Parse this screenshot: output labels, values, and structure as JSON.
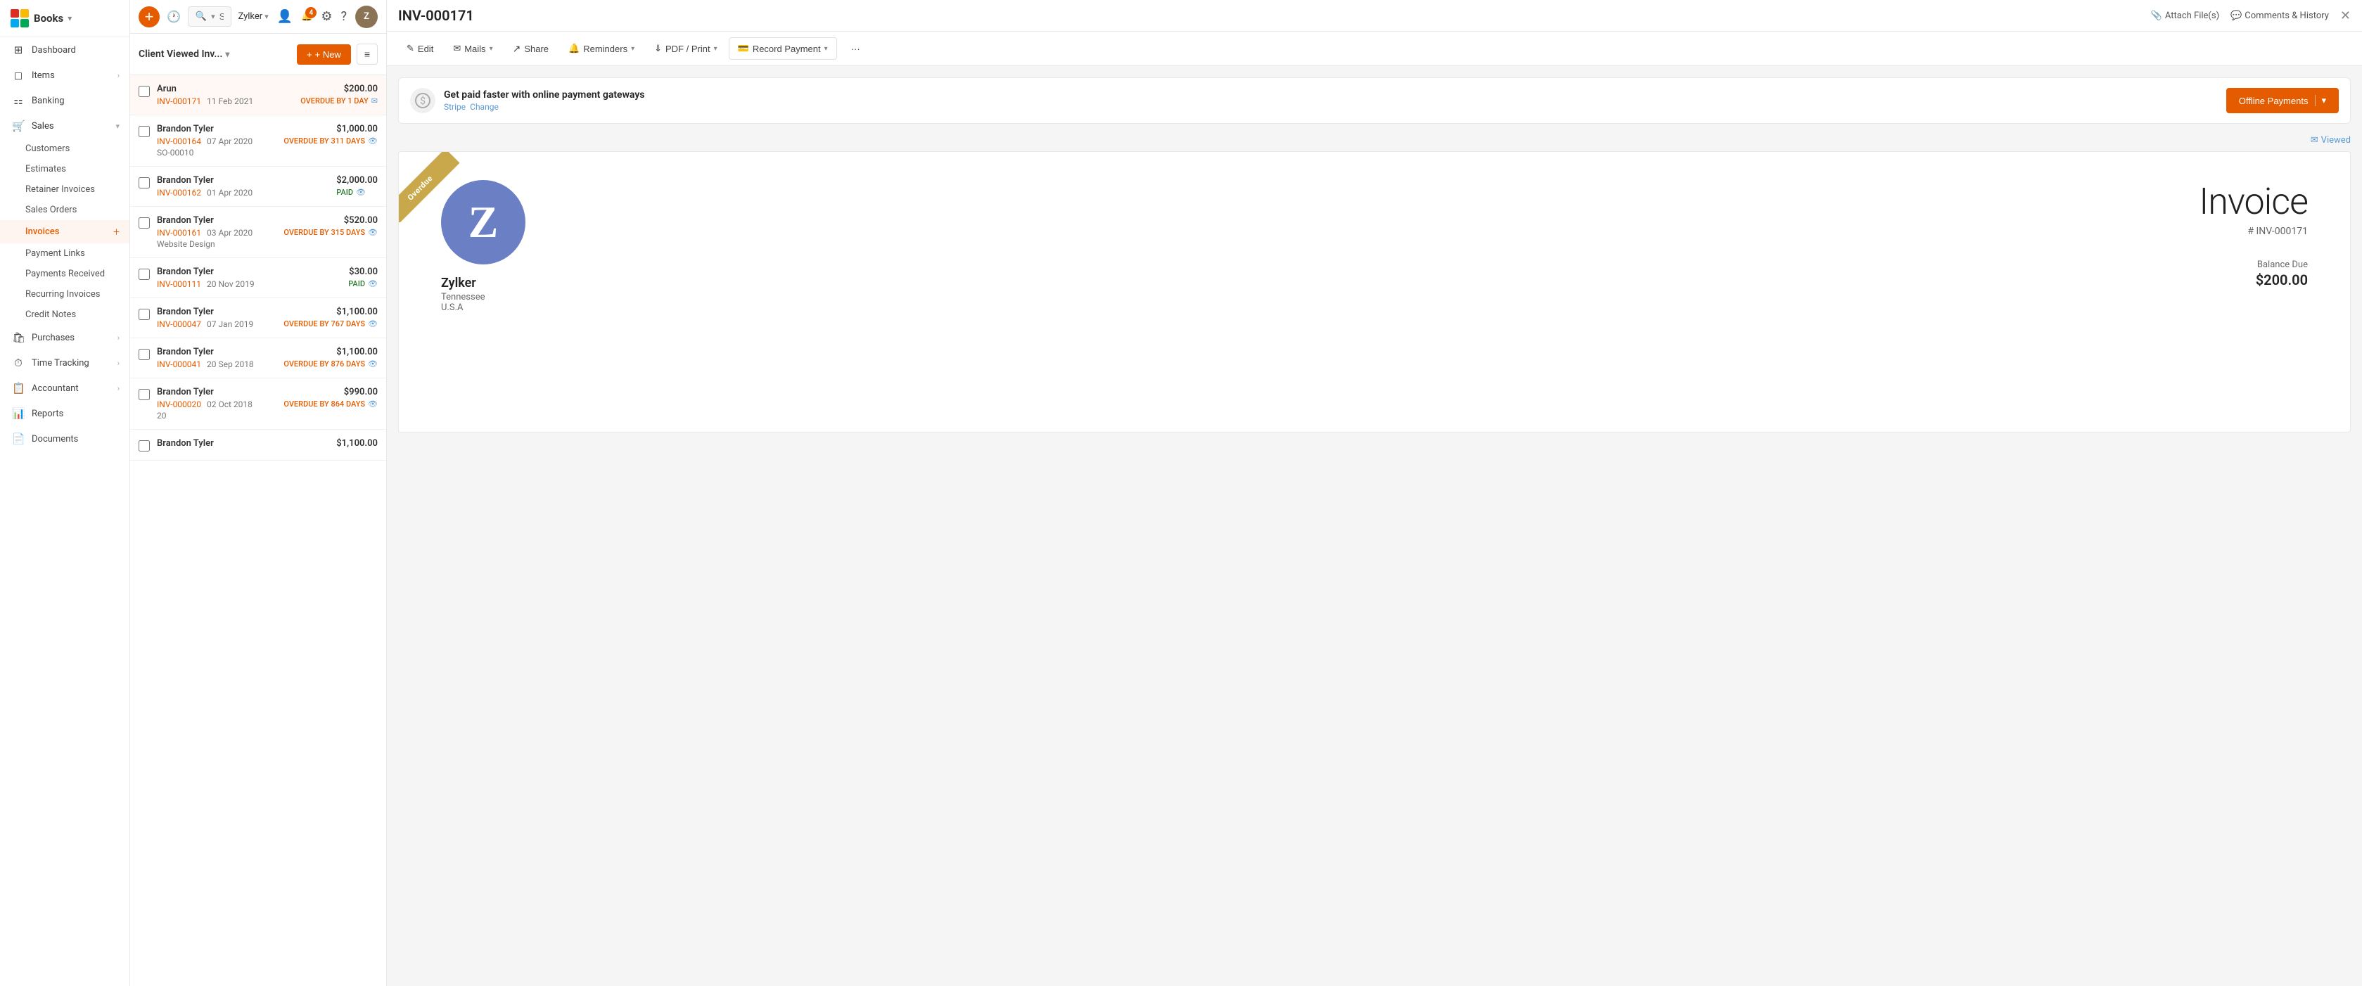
{
  "app": {
    "logo_z": "Z",
    "logo_books": "Books",
    "logo_chevron": "▾"
  },
  "sidebar": {
    "top_items": [
      {
        "id": "dashboard",
        "label": "Dashboard",
        "icon": "⊞"
      },
      {
        "id": "items",
        "label": "Items",
        "icon": "◻",
        "has_arrow": true
      },
      {
        "id": "banking",
        "label": "Banking",
        "icon": "🏦"
      }
    ],
    "sales": {
      "label": "Sales",
      "icon": "🛒",
      "sub_items": [
        {
          "id": "customers",
          "label": "Customers"
        },
        {
          "id": "estimates",
          "label": "Estimates"
        },
        {
          "id": "retainer-invoices",
          "label": "Retainer Invoices"
        },
        {
          "id": "sales-orders",
          "label": "Sales Orders"
        },
        {
          "id": "invoices",
          "label": "Invoices",
          "active": true
        },
        {
          "id": "payment-links",
          "label": "Payment Links"
        },
        {
          "id": "payments-received",
          "label": "Payments Received"
        },
        {
          "id": "recurring-invoices",
          "label": "Recurring Invoices"
        },
        {
          "id": "credit-notes",
          "label": "Credit Notes"
        }
      ]
    },
    "purchases": {
      "label": "Purchases",
      "icon": "🛍",
      "has_arrow": true
    },
    "time_tracking": {
      "label": "Time Tracking",
      "icon": "⏱",
      "has_arrow": true
    },
    "accountant": {
      "label": "Accountant",
      "icon": "📋",
      "has_arrow": true
    },
    "reports": {
      "label": "Reports",
      "icon": "📊"
    },
    "documents": {
      "label": "Documents",
      "icon": "📄"
    }
  },
  "list_panel": {
    "title": "Client Viewed Inv...",
    "btn_new_label": "+ New",
    "invoices": [
      {
        "name": "Arun",
        "number": "INV-000171",
        "date": "11 Feb 2021",
        "amount": "$200.00",
        "status": "OVERDUE BY 1 DAY",
        "status_type": "overdue",
        "note": "",
        "has_mail": true,
        "selected": true
      },
      {
        "name": "Brandon Tyler",
        "number": "INV-000164",
        "date": "07 Apr 2020",
        "amount": "$1,000.00",
        "status": "OVERDUE BY 311 DAYS",
        "status_type": "overdue",
        "note": "SO-00010",
        "has_eye": true
      },
      {
        "name": "Brandon Tyler",
        "number": "INV-000162",
        "date": "01 Apr 2020",
        "amount": "$2,000.00",
        "status": "PAID",
        "status_type": "paid",
        "note": "",
        "has_eye": true
      },
      {
        "name": "Brandon Tyler",
        "number": "INV-000161",
        "date": "03 Apr 2020",
        "amount": "$520.00",
        "status": "OVERDUE BY 315 DAYS",
        "status_type": "overdue",
        "note": "Website Design",
        "has_eye": true
      },
      {
        "name": "Brandon Tyler",
        "number": "INV-000111",
        "date": "20 Nov 2019",
        "amount": "$30.00",
        "status": "PAID",
        "status_type": "paid",
        "note": "",
        "has_eye": true
      },
      {
        "name": "Brandon Tyler",
        "number": "INV-000047",
        "date": "07 Jan 2019",
        "amount": "$1,100.00",
        "status": "OVERDUE BY 767 DAYS",
        "status_type": "overdue",
        "note": "",
        "has_eye": true
      },
      {
        "name": "Brandon Tyler",
        "number": "INV-000041",
        "date": "20 Sep 2018",
        "amount": "$1,100.00",
        "status": "OVERDUE BY 876 DAYS",
        "status_type": "overdue",
        "note": "",
        "has_eye": true
      },
      {
        "name": "Brandon Tyler",
        "number": "INV-000020",
        "date": "02 Oct 2018",
        "amount": "$990.00",
        "status": "OVERDUE BY 864 DAYS",
        "status_type": "overdue",
        "note": "20",
        "has_eye": true
      },
      {
        "name": "Brandon Tyler",
        "number": "",
        "date": "",
        "amount": "$1,100.00",
        "status": "",
        "status_type": "",
        "note": ""
      }
    ]
  },
  "topbar": {
    "search_placeholder": "Search in Invoices",
    "user_name": "Zylker",
    "notif_count": "4"
  },
  "detail": {
    "invoice_id": "INV-000171",
    "attach_label": "Attach File(s)",
    "comments_label": "Comments & History",
    "actions": [
      {
        "id": "edit",
        "label": "Edit",
        "icon": "✎"
      },
      {
        "id": "mails",
        "label": "Mails",
        "icon": "✉",
        "has_dropdown": true
      },
      {
        "id": "share",
        "label": "Share",
        "icon": "↗"
      },
      {
        "id": "reminders",
        "label": "Reminders",
        "icon": "🔔",
        "has_dropdown": true
      },
      {
        "id": "pdf-print",
        "label": "PDF / Print",
        "icon": "⇓",
        "has_dropdown": true
      },
      {
        "id": "record-payment",
        "label": "Record Payment",
        "icon": "💳",
        "has_dropdown": true
      },
      {
        "id": "more",
        "label": "···",
        "icon": ""
      }
    ],
    "gateway_banner": {
      "title": "Get paid faster with online payment gateways",
      "stripe_label": "Stripe",
      "change_label": "Change",
      "offline_btn_label": "Offline Payments"
    },
    "viewed_label": "Viewed",
    "invoice": {
      "overdue_label": "Overdue",
      "company_letter": "Z",
      "company_name": "Zylker",
      "company_city": "Tennessee",
      "company_country": "U.S.A",
      "big_title": "Invoice",
      "number_label": "# INV-000171",
      "balance_label": "Balance Due",
      "balance_amount": "$200.00"
    }
  }
}
